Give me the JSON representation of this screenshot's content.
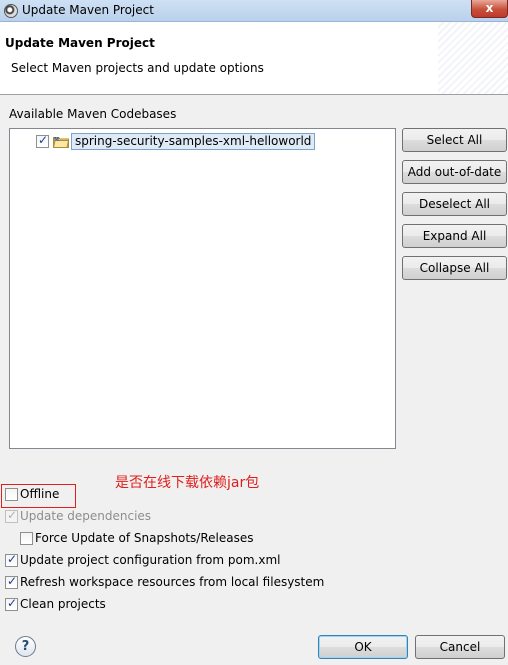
{
  "window": {
    "title": "Update Maven Project",
    "close_glyph": "x"
  },
  "header": {
    "title": "Update Maven Project",
    "description": "Select Maven projects and update options"
  },
  "codebases": {
    "label": "Available Maven Codebases",
    "items": [
      {
        "label": "spring-security-samples-xml-helloworld",
        "checked": true,
        "icon": "maven-folder-icon"
      }
    ]
  },
  "side_buttons": {
    "select_all": "Select All",
    "add_out_of_date": "Add out-of-date",
    "deselect_all": "Deselect All",
    "expand_all": "Expand All",
    "collapse_all": "Collapse All"
  },
  "annotation": {
    "text": "是否在线下载依赖jar包",
    "color": "#e0201e"
  },
  "options": {
    "offline": {
      "label": "Offline",
      "checked": false,
      "enabled": true
    },
    "update_dependencies": {
      "label": "Update dependencies",
      "checked": true,
      "enabled": false
    },
    "force_update": {
      "label": "Force Update of Snapshots/Releases",
      "checked": false,
      "enabled": true
    },
    "update_config": {
      "label": "Update project configuration from pom.xml",
      "checked": true,
      "enabled": true
    },
    "refresh_workspace": {
      "label": "Refresh workspace resources from local filesystem",
      "checked": true,
      "enabled": true
    },
    "clean_projects": {
      "label": "Clean projects",
      "checked": true,
      "enabled": true
    }
  },
  "footer": {
    "help_glyph": "?",
    "ok": "OK",
    "cancel": "Cancel"
  }
}
